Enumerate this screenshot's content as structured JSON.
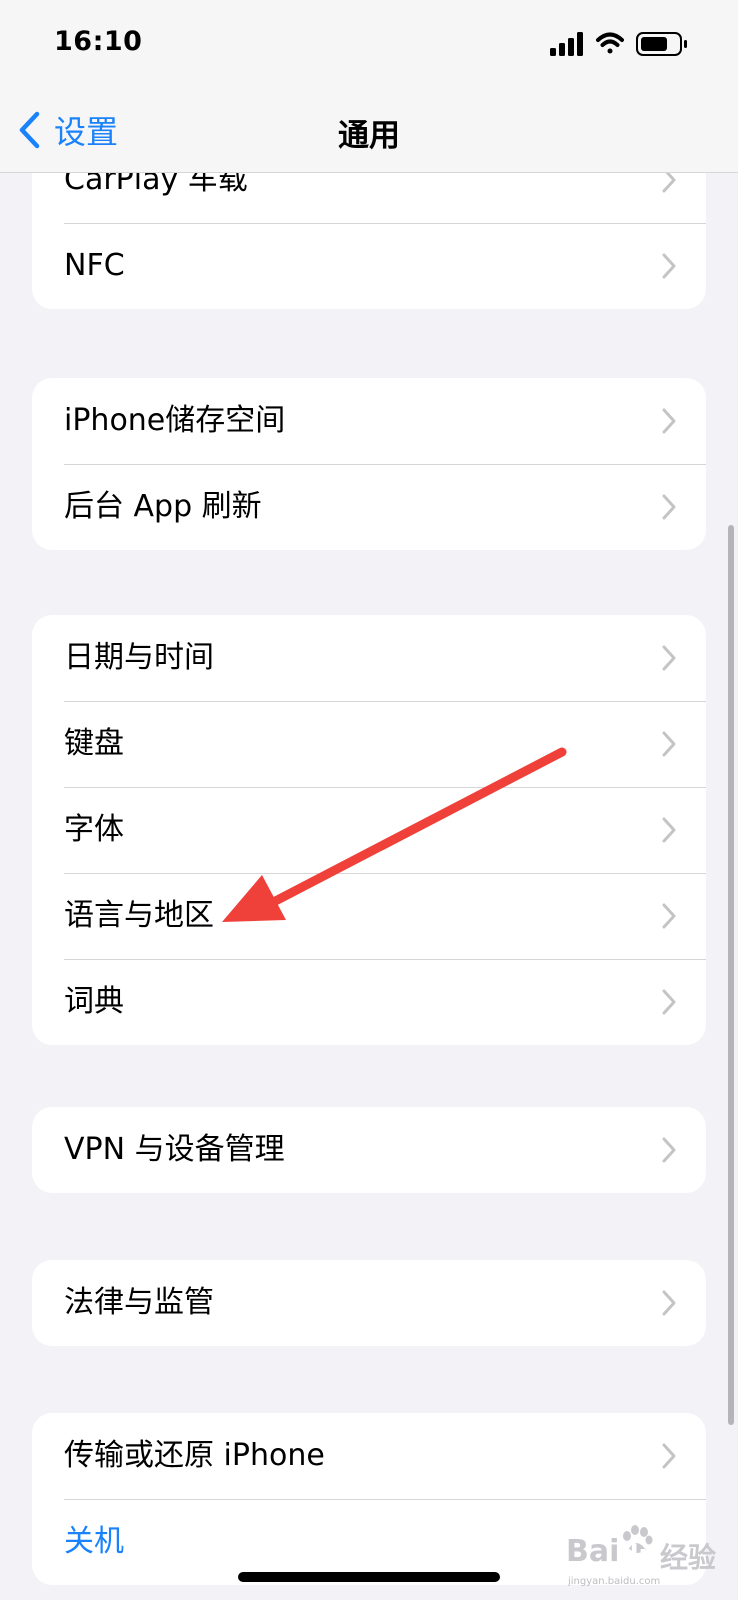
{
  "status_bar": {
    "time": "16:10",
    "icons": [
      "signal-icon",
      "wifi-icon",
      "battery-icon"
    ]
  },
  "nav": {
    "back_label": "设置",
    "title": "通用"
  },
  "groups": [
    {
      "items": [
        "CarPlay 车载",
        "NFC"
      ]
    },
    {
      "items": [
        "iPhone储存空间",
        "后台 App 刷新"
      ]
    },
    {
      "items": [
        "日期与时间",
        "键盘",
        "字体",
        "语言与地区",
        "词典"
      ]
    },
    {
      "items": [
        "VPN 与设备管理"
      ]
    },
    {
      "items": [
        "法律与监管"
      ]
    },
    {
      "items": [
        "传输或还原 iPhone",
        "关机"
      ]
    }
  ],
  "annotation": {
    "arrow_color": "#f0403a",
    "target": "语言与地区"
  },
  "colors": {
    "accent": "#1a82fb",
    "background": "#f2f2f7",
    "separator": "#d6d6da"
  },
  "watermark": {
    "brand": "Bai",
    "brand2": "du",
    "text": "经验",
    "url": "jingyan.baidu.com"
  }
}
